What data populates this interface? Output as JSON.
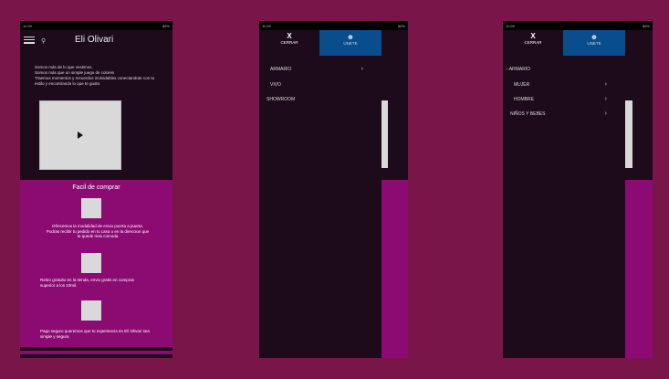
{
  "status": {
    "time": "11:09",
    "battery": "86%"
  },
  "home": {
    "brand": "Eli Olivari",
    "intro": "Somos más de lo que vestimos.\nSomos más que un simple juego de colores\nTraemos momentos y recuerdos inolvidables conectandote con tu estilo y encontrando lo que te guste.",
    "promo_title": "Facil de comprar",
    "promo1": "Ofrecemos la modalidad de envio puerta a puerta. Podras recibir tu pedido en tu casa o en la direccion que te quede mas comoda",
    "promo2": "Retiro gratuito en la tienda, envio gratis en compras superior a los 10mil.",
    "promo3": "Pago seguro queremos que tu experiencia en Eli Olivari sea simple y segura"
  },
  "drawer": {
    "close_label": "CERRAR",
    "join_label": "UNETE",
    "items": [
      "ARMARIO",
      "VIVO",
      "SHOWROOM"
    ]
  },
  "submenu": {
    "back_label": "ARMARIO",
    "items": [
      "MUJER",
      "HOMBRE",
      "NIÑOS Y BEBES"
    ]
  },
  "colors": {
    "background": "#7a1549",
    "magenta": "#8b0b73",
    "dark": "#1d0a1a",
    "blue": "#0a4d8c"
  }
}
